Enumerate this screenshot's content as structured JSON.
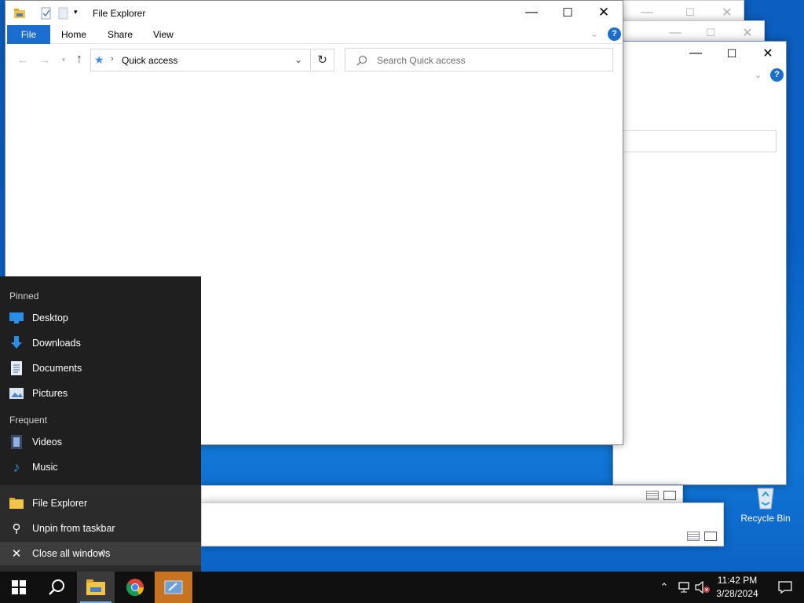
{
  "explorer": {
    "title": "File Explorer",
    "tabs": [
      "File",
      "Home",
      "Share",
      "View"
    ],
    "address": "Quick access",
    "search_placeholder": "Search Quick access"
  },
  "jumplist": {
    "pinned_header": "Pinned",
    "pinned": [
      "Desktop",
      "Downloads",
      "Documents",
      "Pictures"
    ],
    "frequent_header": "Frequent",
    "frequent": [
      "Videos",
      "Music"
    ],
    "tasks": [
      "File Explorer",
      "Unpin from taskbar",
      "Close all windows"
    ]
  },
  "desktop": {
    "recycle_bin_label": "Recycle Bin"
  },
  "tray": {
    "time": "11:42 PM",
    "date": "3/28/2024"
  },
  "colors": {
    "accent": "#1a6ecf",
    "flyout_bg": "#1f1f1f",
    "taskbar_bg": "#101010"
  }
}
